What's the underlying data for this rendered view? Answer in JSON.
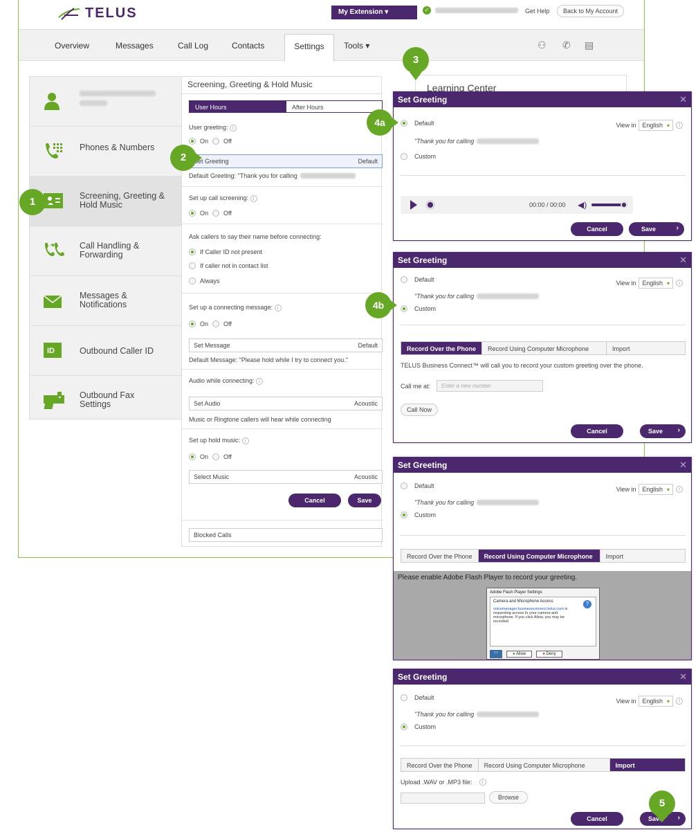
{
  "brand": {
    "name": "TELUS",
    "purple": "#4b286d",
    "green": "#66a825"
  },
  "topbar": {
    "my_extension": "My Extension ▾",
    "get_help": "Get Help",
    "back_to_account": "Back to My Account"
  },
  "nav": {
    "items": [
      "Overview",
      "Messages",
      "Call Log",
      "Contacts",
      "Settings",
      "Tools ▾"
    ],
    "icons": [
      "hierarchy-icon",
      "phone-icon",
      "fax-icon"
    ]
  },
  "sidebar": {
    "items": [
      {
        "label": "",
        "icon": "user-icon"
      },
      {
        "label": "Phones & Numbers",
        "icon": "phone-keypad-icon"
      },
      {
        "label": "Screening, Greeting & Hold Music",
        "icon": "contact-card-icon"
      },
      {
        "label": "Call Handling & Forwarding",
        "icon": "call-forward-icon"
      },
      {
        "label": "Messages & Notifications",
        "icon": "envelope-icon"
      },
      {
        "label": "Outbound Caller ID",
        "icon": "id-badge-icon"
      },
      {
        "label": "Outbound Fax Settings",
        "icon": "fax-machine-icon"
      }
    ]
  },
  "panel": {
    "title": "Screening, Greeting & Hold Music",
    "tabs": [
      "User Hours",
      "After Hours"
    ],
    "user_greeting": "User greeting:",
    "on": "On",
    "off": "Off",
    "set_greeting": "Set Greeting",
    "default_label": "Default",
    "default_greeting": "Default Greeting: \"Thank you for calling",
    "call_screening": "Set up call screening:",
    "ask_callers": "Ask callers to say their name before connecting:",
    "screen_options": [
      "If Caller ID not present",
      "If caller not in contact list",
      "Always"
    ],
    "connecting_message": "Set up a connecting message:",
    "set_message": "Set Message",
    "default_message": "Default Message: \"Please hold while I try to connect you.\"",
    "audio_connecting": "Audio while connecting:",
    "set_audio": "Set Audio",
    "acoustic": "Acoustic",
    "audio_note": "Music or Ringtone callers will hear while connecting",
    "hold_music": "Set up hold music:",
    "select_music": "Select Music",
    "cancel": "Cancel",
    "save": "Save",
    "blocked_calls": "Blocked Calls"
  },
  "learning_center": "Learning Center",
  "callouts": [
    "1",
    "2",
    "3",
    "4a",
    "4b",
    "5"
  ],
  "dialog": {
    "title": "Set Greeting",
    "default": "Default",
    "custom": "Custom",
    "view_in": "View in",
    "language": "English",
    "thank_you": "\"Thank you for calling",
    "time": "00:00 / 00:00",
    "cancel": "Cancel",
    "save": "Save",
    "tabs": [
      "Record Over the Phone",
      "Record Using Computer Microphone",
      "Import"
    ],
    "phone_note": "TELUS Business Connect™ will call you to record your custom greeting over the phone.",
    "call_me_at": "Call me at:",
    "call_placeholder": "Enter a new number",
    "call_now": "Call Now",
    "flash_msg": "Please enable Adobe Flash Player to record your greeting.",
    "flash_title": "Adobe Flash Player Settings",
    "flash_heading": "Camera and Microphone Access",
    "flash_link": "voicemanager.businessconnect.telus.com",
    "flash_body": " is requesting access to your camera and microphone. If you click Allow, you may be recorded.",
    "flash_allow": "Allow",
    "flash_deny": "Deny",
    "upload_label": "Upload .WAV or .MP3 file:",
    "browse": "Browse"
  }
}
